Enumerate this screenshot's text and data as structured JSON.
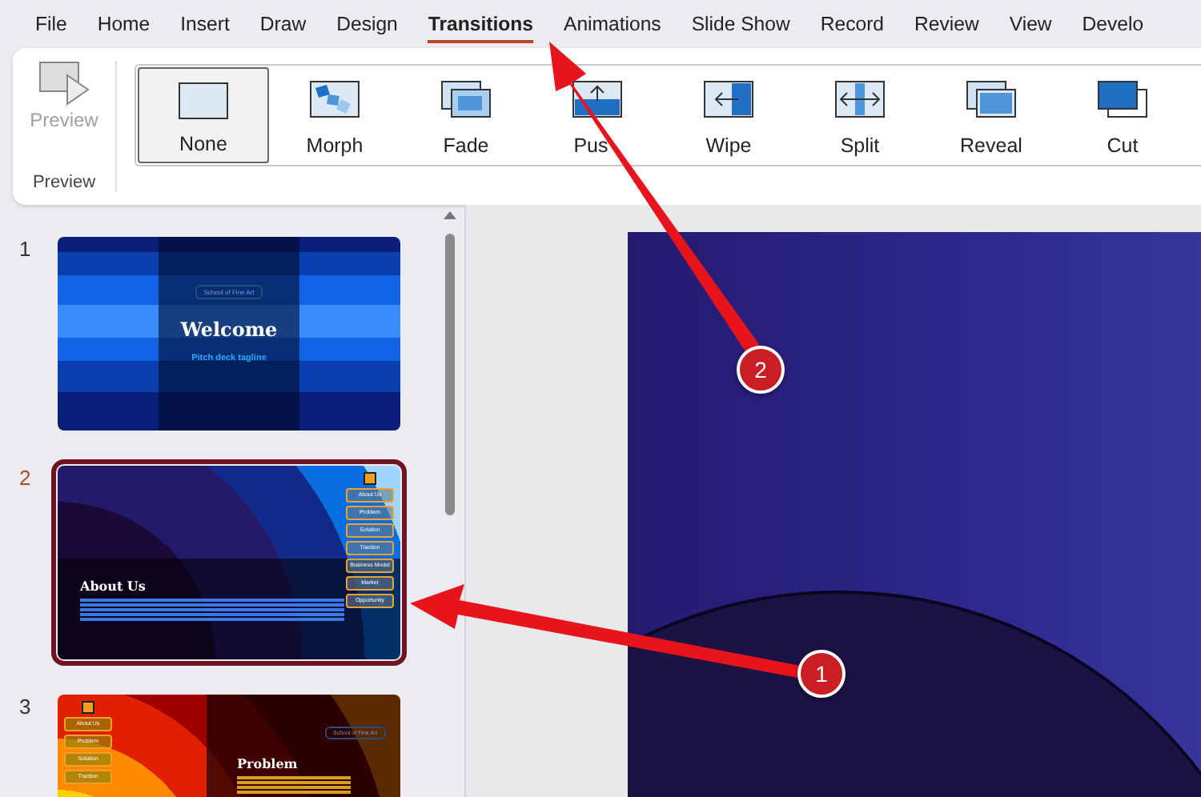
{
  "ribbon_tabs": [
    {
      "label": "File",
      "selected": false
    },
    {
      "label": "Home",
      "selected": false
    },
    {
      "label": "Insert",
      "selected": false
    },
    {
      "label": "Draw",
      "selected": false
    },
    {
      "label": "Design",
      "selected": false
    },
    {
      "label": "Transitions",
      "selected": true
    },
    {
      "label": "Animations",
      "selected": false
    },
    {
      "label": "Slide Show",
      "selected": false
    },
    {
      "label": "Record",
      "selected": false
    },
    {
      "label": "Review",
      "selected": false
    },
    {
      "label": "View",
      "selected": false
    },
    {
      "label": "Develo",
      "selected": false
    }
  ],
  "preview_group": {
    "button": "Preview",
    "disabled": true,
    "label": "Preview"
  },
  "transitions": [
    {
      "kind": "none",
      "label": "None",
      "selected": true
    },
    {
      "kind": "morph",
      "label": "Morph",
      "selected": false
    },
    {
      "kind": "fade",
      "label": "Fade",
      "selected": false
    },
    {
      "kind": "push",
      "label": "Pus",
      "selected": false
    },
    {
      "kind": "wipe",
      "label": "Wipe",
      "selected": false
    },
    {
      "kind": "split",
      "label": "Split",
      "selected": false
    },
    {
      "kind": "reveal",
      "label": "Reveal",
      "selected": false
    },
    {
      "kind": "cut",
      "label": "Cut",
      "selected": false
    }
  ],
  "slides": [
    {
      "number": "1",
      "selected": false,
      "kind": "title",
      "school": "School of Fine Art",
      "title": "Welcome",
      "tagline": "Pitch deck tagline"
    },
    {
      "number": "2",
      "selected": true,
      "kind": "about",
      "title": "About Us",
      "nav": [
        "About Us",
        "Problem",
        "Solution",
        "Traction",
        "Business Model",
        "Market",
        "Opportunity"
      ]
    },
    {
      "number": "3",
      "selected": false,
      "kind": "problem",
      "title": "Problem",
      "school": "School of Fine Art",
      "nav": [
        "About Us",
        "Problem",
        "Solution",
        "Traction"
      ]
    }
  ],
  "annotations": [
    {
      "number": "1"
    },
    {
      "number": "2"
    }
  ]
}
